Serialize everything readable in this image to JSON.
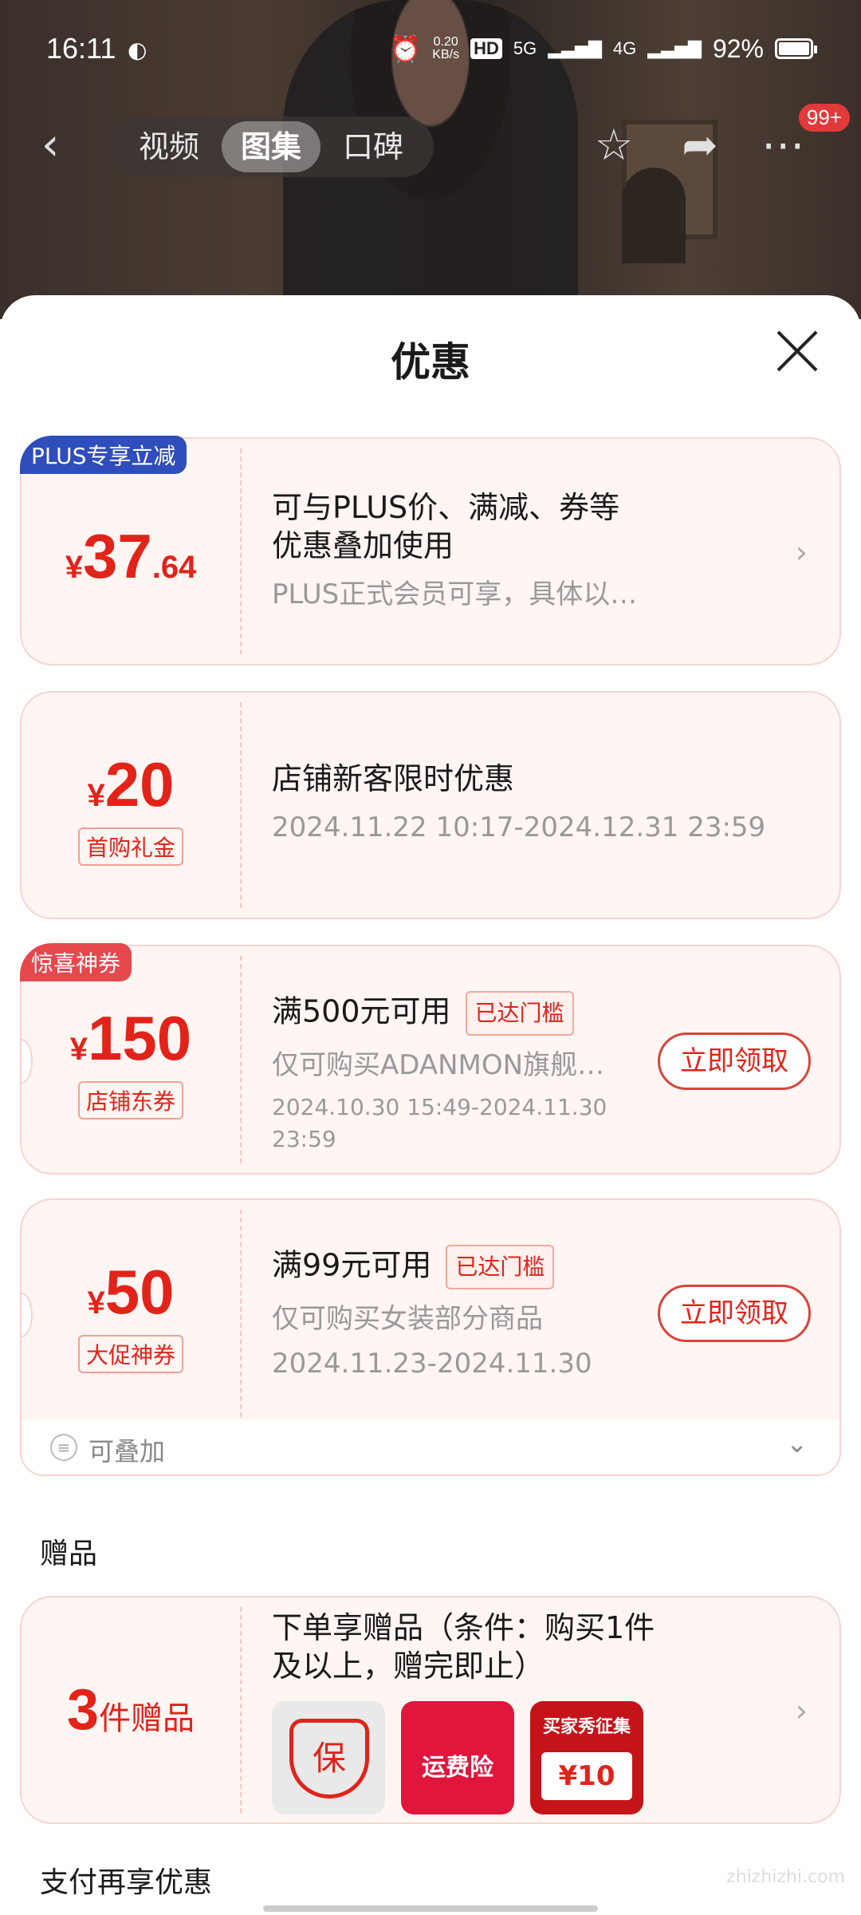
{
  "status": {
    "time": "16:11",
    "net_speed_top": "0.20",
    "net_speed_bottom": "KB/s",
    "hd": "HD",
    "sig1": "5G",
    "sig2": "4G",
    "battery": "92%"
  },
  "nav": {
    "tabs": [
      "视频",
      "图集",
      "口碑"
    ],
    "active_tab": 1,
    "more_badge": "99+"
  },
  "sheet": {
    "title": "优惠"
  },
  "coupons": [
    {
      "corner_tag": "PLUS专享立减",
      "corner_color": "#2f4dbb",
      "currency": "¥",
      "amount": "37",
      "decimal": ".64",
      "line1": "可与PLUS价、满减、券等",
      "line1b": "优惠叠加使用",
      "line2": "PLUS正式会员可享，具体以…"
    },
    {
      "currency": "¥",
      "amount": "20",
      "tag": "首购礼金",
      "line1": "店铺新客限时优惠",
      "line2": "2024.11.22 10:17-2024.12.31 23:59"
    },
    {
      "corner_tag": "惊喜神券",
      "corner_color": "#e5484d",
      "currency": "¥",
      "amount": "150",
      "tag": "店铺东券",
      "line1": "满500元可用",
      "reach": "已达门槛",
      "line2": "仅可购买ADANMON旗舰…",
      "line3": "2024.10.30 15:49-2024.11.30 23:59",
      "button": "立即领取"
    },
    {
      "currency": "¥",
      "amount": "50",
      "tag": "大促神券",
      "line1": "满99元可用",
      "reach": "已达门槛",
      "line2": "仅可购买女装部分商品",
      "line3": "2024.11.23-2024.11.30",
      "button": "立即领取"
    }
  ],
  "stackable": {
    "label": "可叠加"
  },
  "gifts": {
    "section_title": "赠品",
    "count": "3",
    "unit": "件赠品",
    "line1": "下单享赠品（条件：购买1件",
    "line1b": "及以上，赠完即止）",
    "items": [
      {
        "icon": "保",
        "sub": "¥"
      },
      {
        "label": "运费险"
      },
      {
        "label": "买家秀征集",
        "ticket": "¥10"
      }
    ]
  },
  "pay_section": {
    "title": "支付再享优惠"
  },
  "watermark": "zhizhizhi.com",
  "colors": {
    "accent_red": "#e2231a",
    "plus_blue": "#2f4dbb",
    "surprise_red": "#e5484d",
    "card_bg": "#fff5f3"
  }
}
